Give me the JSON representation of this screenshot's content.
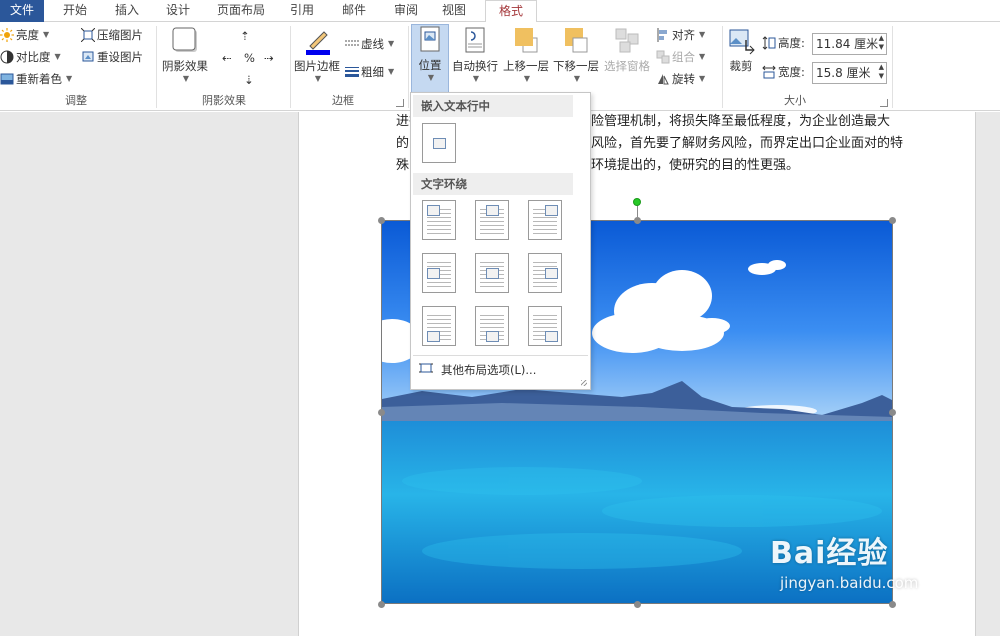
{
  "tabs": [
    {
      "label": "文件"
    },
    {
      "label": "开始"
    },
    {
      "label": "插入"
    },
    {
      "label": "设计"
    },
    {
      "label": "页面布局"
    },
    {
      "label": "引用"
    },
    {
      "label": "邮件"
    },
    {
      "label": "审阅"
    },
    {
      "label": "视图"
    },
    {
      "label": "格式"
    }
  ],
  "ribbon": {
    "adjust": {
      "brightness": "亮度",
      "contrast": "对比度",
      "recolor": "重新着色",
      "compress": "压缩图片",
      "reset": "重设图片",
      "label": "调整"
    },
    "shadow": {
      "effects": "阴影效果",
      "label": "阴影效果"
    },
    "border": {
      "picture_border": "图片边框",
      "dashes": "虚线",
      "weight": "粗细",
      "label": "边框"
    },
    "arrange": {
      "position": "位置",
      "wrap": "自动换行",
      "forward": "上移一层",
      "backward": "下移一层",
      "selection_pane": "选择窗格",
      "align": "对齐",
      "group": "组合",
      "rotate": "旋转"
    },
    "size": {
      "crop": "裁剪",
      "height_label": "高度:",
      "height_value": "11.84 厘米",
      "width_label": "宽度:",
      "width_value": "15.8 厘米",
      "label": "大小"
    }
  },
  "document": {
    "line1": "进行财务风险管理机制，将损失降至最低程度，为企业创造最大",
    "line1_visible": "进行",
    "line1_right": "险管理机制，将损失降至最低程度，为企业创造最大",
    "line2_left": "的",
    "line2_right": "风险，首先要了解财务风险，而界定出口企业面对的特",
    "line3_left": "殊",
    "line3_right": "环境提出的，使研究的目的性更强。"
  },
  "dropdown": {
    "inline_header": "嵌入文本行中",
    "wrap_header": "文字环绕",
    "more_options": "其他布局选项(L)..."
  },
  "watermark": {
    "brand": "Bai经验",
    "url": "jingyan.baidu.com"
  },
  "colors": {
    "file_tab": "#2b579a",
    "active_tab_text": "#a4373a",
    "selected_button": "#c5d9f1"
  }
}
